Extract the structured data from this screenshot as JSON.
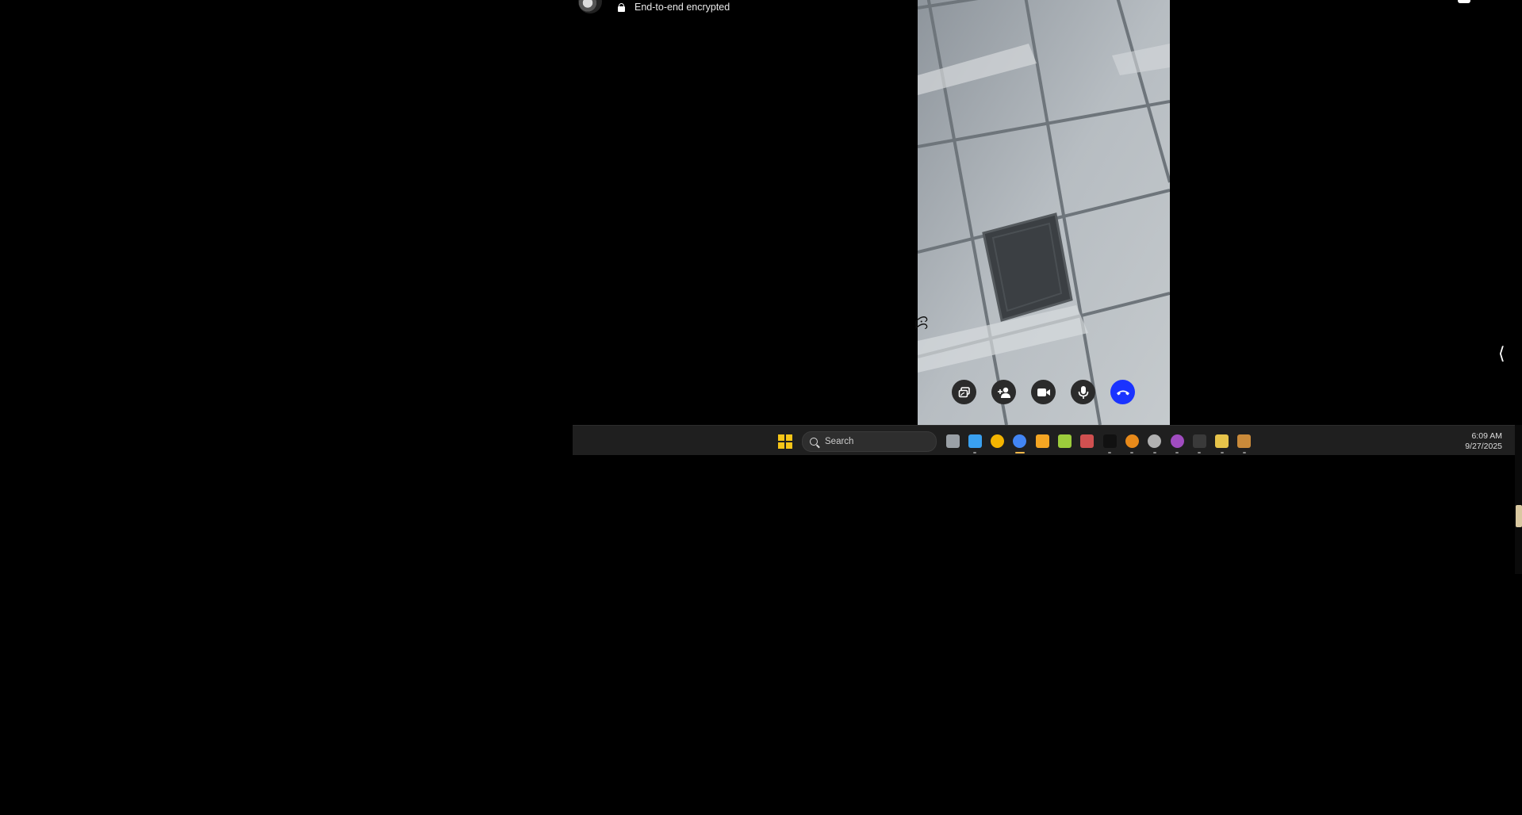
{
  "call": {
    "encryption_label": "End-to-end encrypted",
    "controls": [
      {
        "name": "share-screen-button",
        "icon": "share-screen-icon"
      },
      {
        "name": "add-people-button",
        "icon": "add-person-icon"
      },
      {
        "name": "camera-button",
        "icon": "video-camera-icon"
      },
      {
        "name": "microphone-button",
        "icon": "microphone-icon"
      },
      {
        "name": "end-call-button",
        "icon": "hang-up-icon",
        "color": "#1a33ff"
      }
    ]
  },
  "sidebar": {
    "collapse_glyph": "⟨"
  },
  "taskbar": {
    "search_placeholder": "Search",
    "apps": [
      {
        "name": "task-view",
        "icon": "task-view-icon",
        "color": "#9aa0a6"
      },
      {
        "name": "file-explorer",
        "icon": "folder-icon",
        "color": "#3aa0f0"
      },
      {
        "name": "google-app",
        "icon": "google-icon",
        "color": "#f4b400"
      },
      {
        "name": "chrome",
        "icon": "chrome-icon",
        "color": "#4285f4"
      },
      {
        "name": "vscode",
        "icon": "vscode-icon",
        "color": "#f5a623"
      },
      {
        "name": "snipping-tool",
        "icon": "snipping-icon",
        "color": "#9ccc3c"
      },
      {
        "name": "teams",
        "icon": "teams-icon",
        "color": "#d05050"
      },
      {
        "name": "capcut",
        "icon": "capcut-icon",
        "color": "#111111"
      },
      {
        "name": "edge",
        "icon": "edge-icon",
        "color": "#e88a1a"
      },
      {
        "name": "settings",
        "icon": "gear-icon",
        "color": "#b0b0b0"
      },
      {
        "name": "github-desktop",
        "icon": "github-icon",
        "color": "#a04cc0"
      },
      {
        "name": "terminal",
        "icon": "terminal-icon",
        "color": "#3a3a3a"
      },
      {
        "name": "notepad",
        "icon": "notepad-icon",
        "color": "#e6c34a"
      },
      {
        "name": "remote-desktop",
        "icon": "remote-desktop-icon",
        "color": "#c98a3a"
      }
    ],
    "active_app": "chrome",
    "time": "6:09 AM",
    "date": "9/27/2025"
  }
}
